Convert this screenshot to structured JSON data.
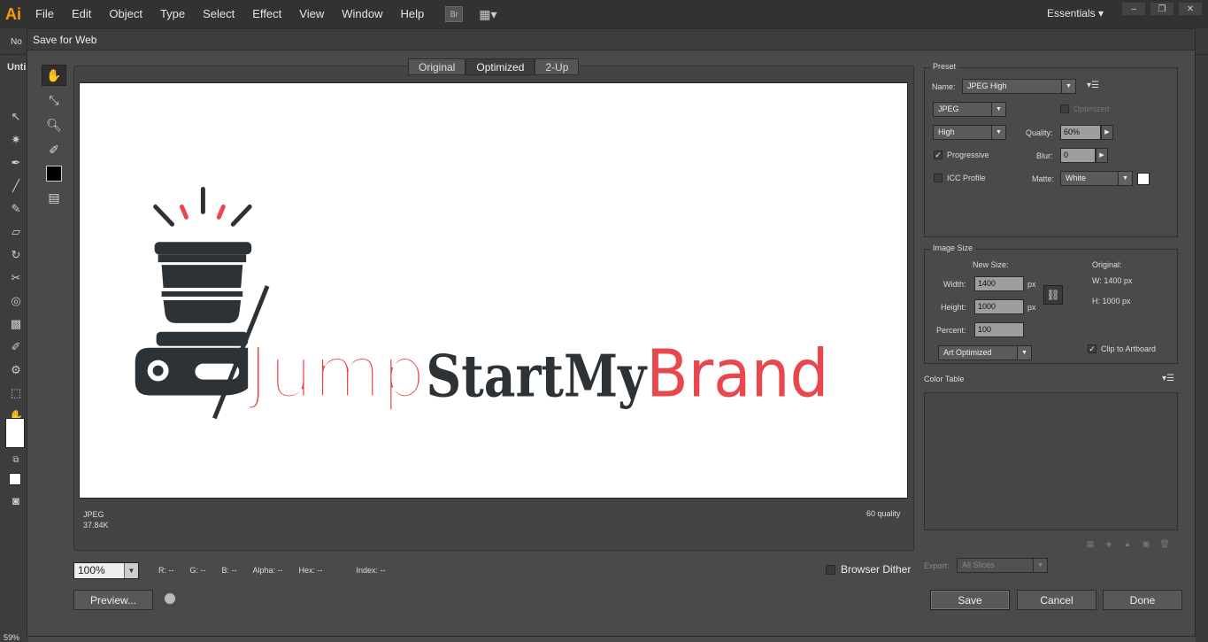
{
  "app": {
    "logo": "Ai",
    "menu": [
      "File",
      "Edit",
      "Object",
      "Type",
      "Select",
      "Effect",
      "View",
      "Window",
      "Help"
    ],
    "bridge_label": "Br",
    "workspace": "Essentials",
    "left_tab_label": "Unti",
    "left_no_label": "No",
    "zoom_status": "59%"
  },
  "dialog": {
    "title": "Save for Web",
    "tabs": [
      "Original",
      "Optimized",
      "2-Up"
    ],
    "active_tab": "Optimized",
    "canvas_logo": {
      "part1": "Jump",
      "part2": "StartMy",
      "part3": "Brand",
      "color_dark": "#2d3236",
      "color_red": "#e8474d"
    },
    "info_left": {
      "format": "JPEG",
      "size": "37.84K"
    },
    "info_right": "60 quality",
    "zoom": "100%",
    "readouts": [
      "R: --",
      "G: --",
      "B: --",
      "Alpha: --",
      "Hex: --",
      "Index: --"
    ],
    "browser_dither": "Browser Dither",
    "preview_button": "Preview...",
    "save_button": "Save",
    "cancel_button": "Cancel",
    "done_button": "Done"
  },
  "preset": {
    "group_label": "Preset",
    "name_label": "Name:",
    "name_value": "JPEG High",
    "format": "JPEG",
    "optimized_label": "Optimized",
    "quality_preset": "High",
    "quality_label": "Quality:",
    "quality_value": "60%",
    "progressive_label": "Progressive",
    "progressive_checked": true,
    "blur_label": "Blur:",
    "blur_value": "0",
    "icc_label": "ICC Profile",
    "matte_label": "Matte:",
    "matte_value": "White"
  },
  "image_size": {
    "group_label": "Image Size",
    "new_size_label": "New Size:",
    "width_label": "Width:",
    "width_value": "1400",
    "height_label": "Height:",
    "height_value": "1000",
    "percent_label": "Percent:",
    "percent_value": "100",
    "px": "px",
    "original_label": "Original:",
    "orig_w": "W:   1400 px",
    "orig_h": "H:   1000 px",
    "resample": "Art Optimized",
    "clip_label": "Clip to Artboard",
    "clip_checked": true
  },
  "color_table": {
    "label": "Color Table"
  },
  "export": {
    "label": "Export:",
    "value": "All Slices"
  }
}
